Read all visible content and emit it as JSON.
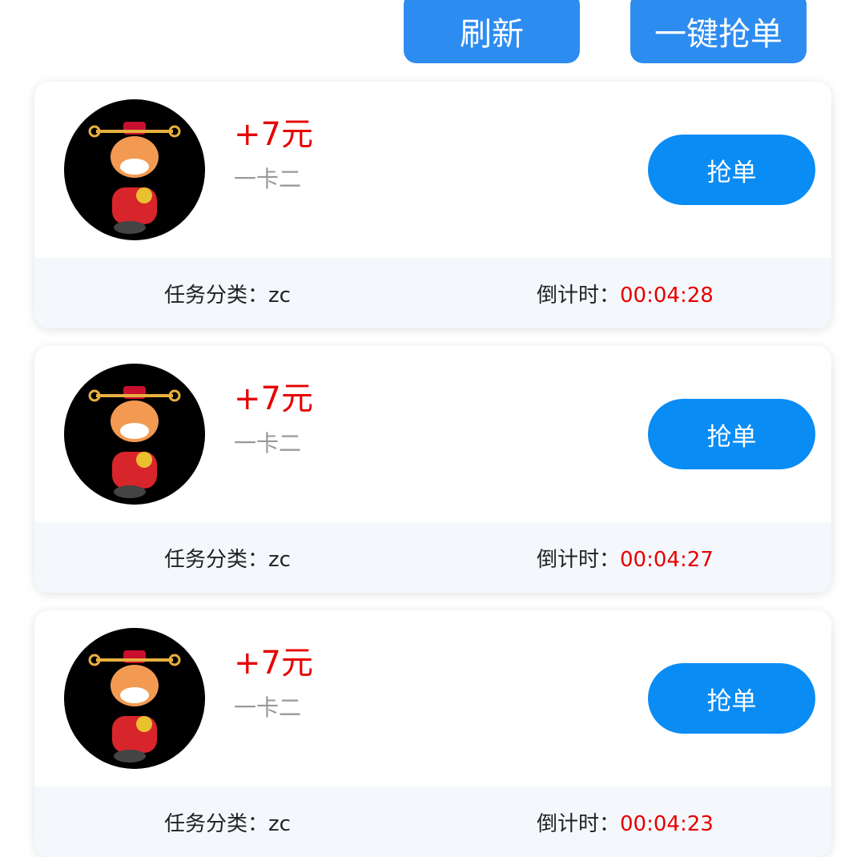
{
  "toolbar": {
    "refresh_label": "刷新",
    "grab_all_label": "一键抢单"
  },
  "colors": {
    "accent": "#2d8cf0",
    "price": "#e60000",
    "footer_bg": "#f4f8fc"
  },
  "orders": [
    {
      "price": "+7元",
      "subtitle": "一卡二",
      "button": "抢单",
      "category_label": "任务分类：",
      "category_value": "zc",
      "countdown_label": "倒计时：",
      "countdown_value": "00:04:28"
    },
    {
      "price": "+7元",
      "subtitle": "一卡二",
      "button": "抢单",
      "category_label": "任务分类：",
      "category_value": "zc",
      "countdown_label": "倒计时：",
      "countdown_value": "00:04:27"
    },
    {
      "price": "+7元",
      "subtitle": "一卡二",
      "button": "抢单",
      "category_label": "任务分类：",
      "category_value": "zc",
      "countdown_label": "倒计时：",
      "countdown_value": "00:04:23"
    }
  ],
  "icons": {
    "avatar": "cartoon-ox-god-of-wealth-avatar"
  }
}
